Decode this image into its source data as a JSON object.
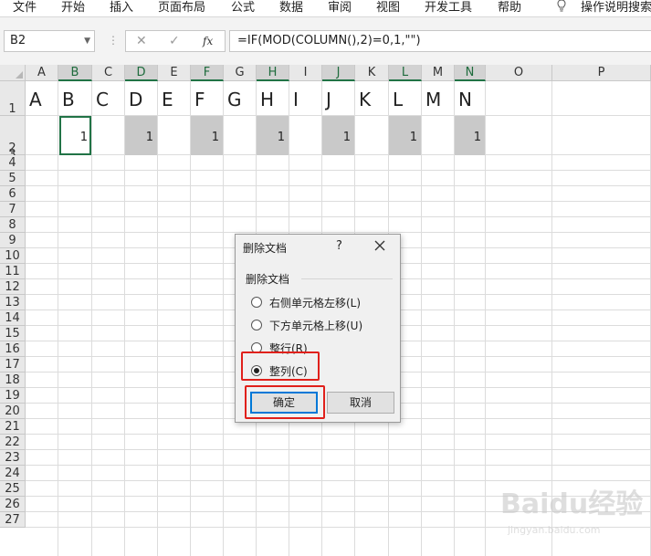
{
  "ribbon": {
    "tabs": [
      "文件",
      "开始",
      "插入",
      "页面布局",
      "公式",
      "数据",
      "审阅",
      "视图",
      "开发工具",
      "帮助"
    ],
    "tell_me": "操作说明搜索"
  },
  "formula_bar": {
    "name_box": "B2",
    "cancel_icon": "✕",
    "enter_icon": "✓",
    "fx_label": "fx",
    "formula": "=IF(MOD(COLUMN(),2)=0,1,\"\")"
  },
  "sheet": {
    "columns": [
      "A",
      "B",
      "C",
      "D",
      "E",
      "F",
      "G",
      "H",
      "I",
      "J",
      "K",
      "L",
      "M",
      "N",
      "O",
      "P"
    ],
    "selected_columns": [
      "B",
      "D",
      "F",
      "H",
      "J",
      "L",
      "N"
    ],
    "rows": [
      "1",
      "2",
      "3",
      "4",
      "5",
      "6",
      "7",
      "8",
      "9",
      "10",
      "11",
      "12",
      "13",
      "14",
      "15",
      "16",
      "17",
      "18",
      "19",
      "20",
      "21",
      "22",
      "23",
      "24",
      "25",
      "26",
      "27"
    ],
    "row1_values": [
      "A",
      "B",
      "C",
      "D",
      "E",
      "F",
      "G",
      "H",
      "I",
      "J",
      "K",
      "L",
      "M",
      "N"
    ],
    "row2_value": "1",
    "active_cell": "B2"
  },
  "dialog": {
    "title": "删除文档",
    "help": "?",
    "group_label": "删除文档",
    "options": [
      "右侧单元格左移(L)",
      "下方单元格上移(U)",
      "整行(R)",
      "整列(C)"
    ],
    "selected_option": 3,
    "ok_label": "确定",
    "cancel_label": "取消",
    "highlight_color": "#e0201b"
  },
  "watermark": {
    "logo": "Baidu经验",
    "url": "jingyan.baidu.com"
  }
}
